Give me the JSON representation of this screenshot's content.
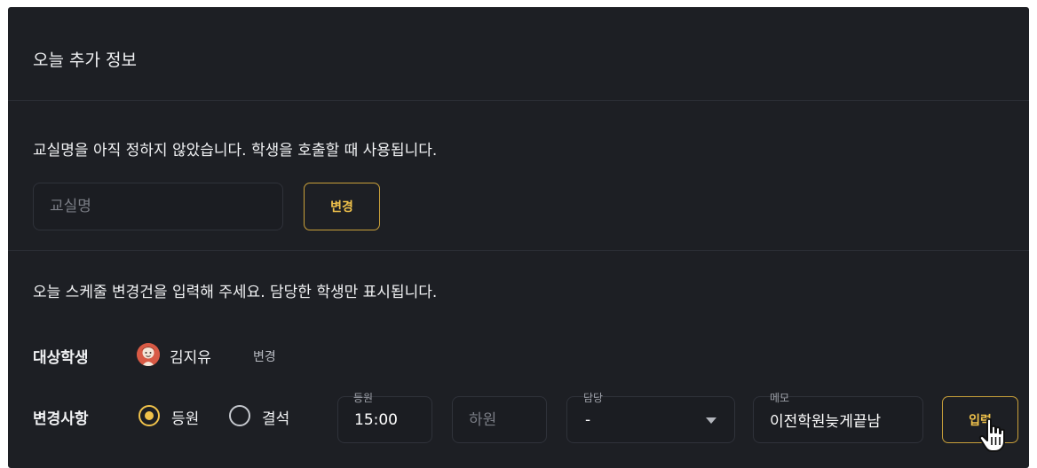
{
  "header": {
    "title": "오늘 추가 정보"
  },
  "classroom": {
    "description": "교실명을 아직 정하지 않았습니다. 학생을 호출할 때 사용됩니다.",
    "input_placeholder": "교실명",
    "input_value": "",
    "change_button": "변경"
  },
  "schedule": {
    "description": "오늘 스케줄 변경건을 입력해 주세요. 담당한 학생만 표시됩니다.",
    "target_label": "대상학생",
    "student_name": "김지유",
    "student_change": "변경",
    "change_label": "변경사항",
    "options": [
      {
        "label": "등원",
        "selected": true
      },
      {
        "label": "결석",
        "selected": false
      }
    ],
    "attend_label": "등원",
    "attend_value": "15:00",
    "leave_placeholder": "하원",
    "teacher_label": "담당",
    "teacher_value": "-",
    "memo_label": "메모",
    "memo_value": "이전학원늦게끝남",
    "submit_button": "입력"
  },
  "colors": {
    "background": "#1d1f24",
    "accent": "#f0c24b",
    "border": "#2f323a",
    "divider": "#2c2f36"
  },
  "icons": [
    "avatar-illustration",
    "radio-selected-icon",
    "radio-unselected-icon",
    "chevron-down-icon",
    "hand-pointer-cursor-icon"
  ]
}
